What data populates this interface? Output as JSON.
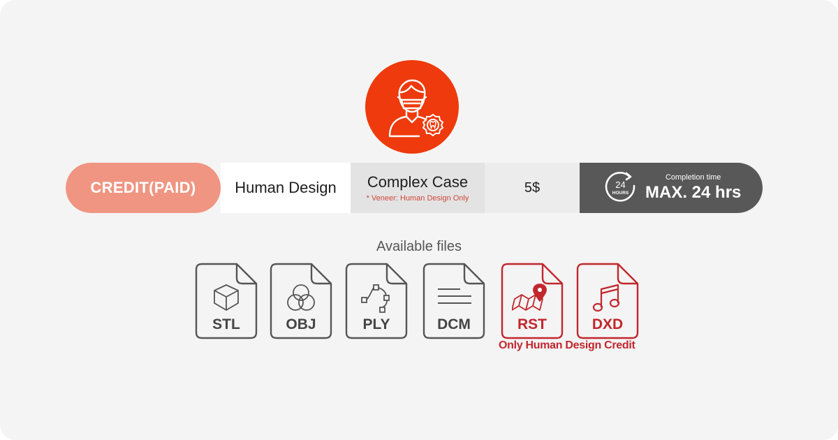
{
  "avatar": {
    "icon": "dentist-masked-person-icon",
    "badge_icon": "tooth-badge-icon",
    "color": "#ee3a0c"
  },
  "plan_bar": {
    "credit_label": "CREDIT(PAID)",
    "design_label": "Human Design",
    "case_title": "Complex Case",
    "case_note": "* Veneer: Human Design Only",
    "price": "5$",
    "time_icon": "24-hours-clock-icon",
    "time_icon_number": "24",
    "time_icon_text": "HOURS",
    "completion_label": "Completion time",
    "completion_value": "MAX. 24 hrs",
    "colors": {
      "credit": "#ef9582",
      "time": "#585858",
      "note": "#d0473b"
    }
  },
  "files": {
    "title": "Available files",
    "items": [
      {
        "ext": "STL",
        "icon": "cube-icon",
        "restricted": false
      },
      {
        "ext": "OBJ",
        "icon": "three-circles-icon",
        "restricted": false
      },
      {
        "ext": "PLY",
        "icon": "vector-path-icon",
        "restricted": false
      },
      {
        "ext": "DCM",
        "icon": "lines-document-icon",
        "restricted": false
      },
      {
        "ext": "RST",
        "icon": "map-pin-icon",
        "restricted": true
      },
      {
        "ext": "DXD",
        "icon": "music-note-icon",
        "restricted": true
      }
    ],
    "restricted_note": "Only Human Design Credit",
    "colors": {
      "normal": "#555555",
      "restricted": "#c1272d"
    }
  }
}
